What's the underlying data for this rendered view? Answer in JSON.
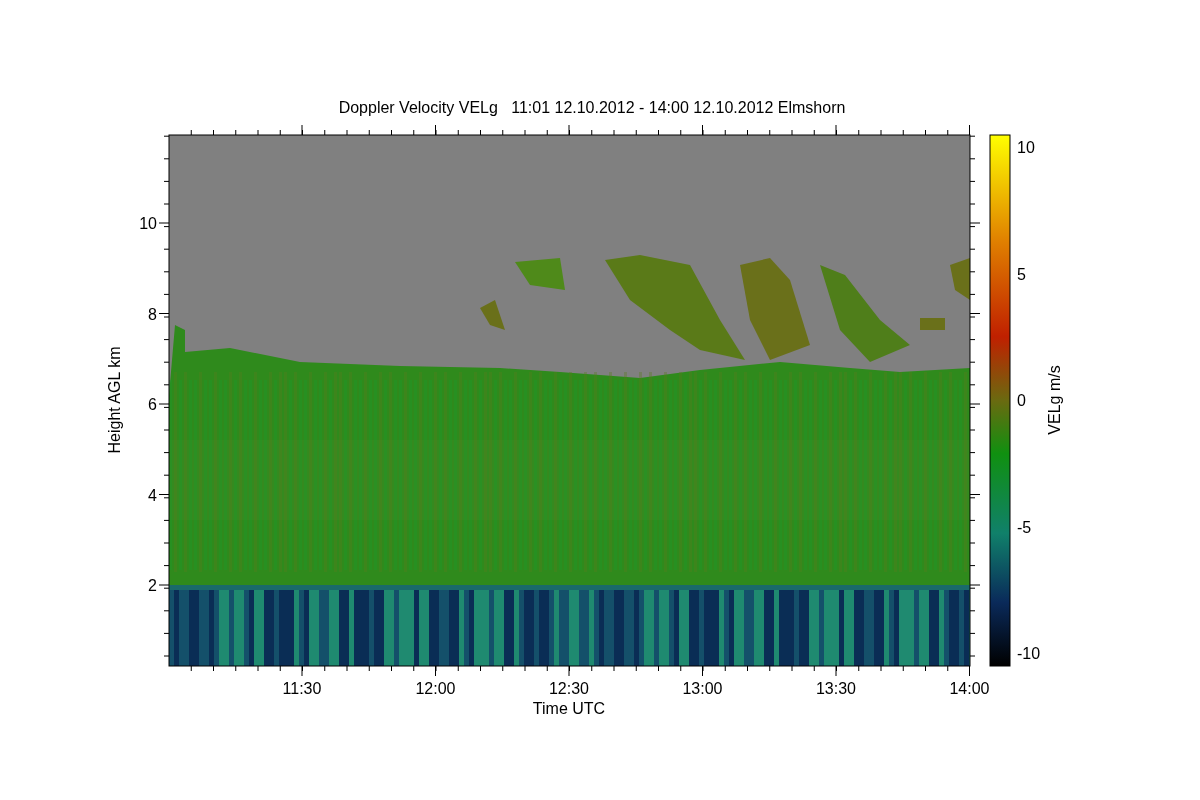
{
  "title": "Doppler Velocity VELg   11:01 12.10.2012 - 14:00 12.10.2012 Elmshorn",
  "y_axis": {
    "label": "Height AGL km",
    "ticks": [
      "10",
      "8",
      "6",
      "4",
      "2"
    ]
  },
  "x_axis": {
    "label": "Time UTC",
    "ticks": [
      "11:30",
      "12:00",
      "12:30",
      "13:00",
      "13:30",
      "14:00"
    ]
  },
  "colorbar": {
    "label": "VELg m/s",
    "ticks": [
      "10",
      "5",
      "0",
      "-5",
      "-10"
    ]
  }
}
